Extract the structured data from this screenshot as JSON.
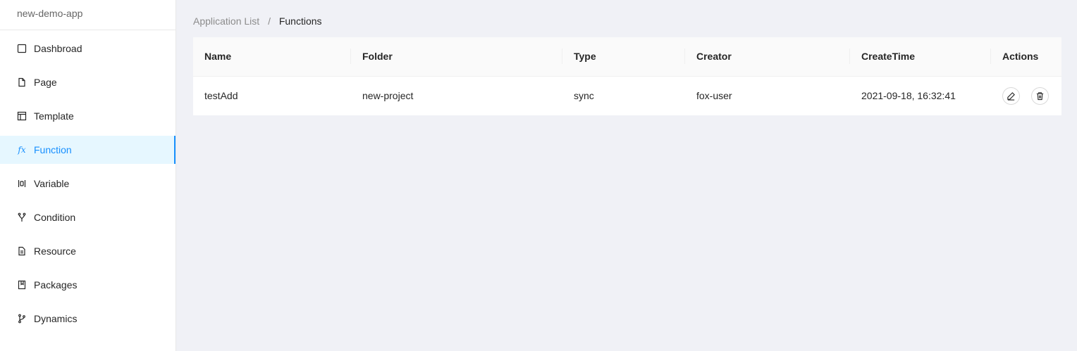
{
  "app": {
    "name": "new-demo-app"
  },
  "sidebar": {
    "items": [
      {
        "label": "Dashbroad",
        "icon": "square-icon",
        "active": false
      },
      {
        "label": "Page",
        "icon": "file-icon",
        "active": false
      },
      {
        "label": "Template",
        "icon": "layout-icon",
        "active": false
      },
      {
        "label": "Function",
        "icon": "fx-icon",
        "active": true
      },
      {
        "label": "Variable",
        "icon": "variable-icon",
        "active": false
      },
      {
        "label": "Condition",
        "icon": "branch-icon",
        "active": false
      },
      {
        "label": "Resource",
        "icon": "file-text-icon",
        "active": false
      },
      {
        "label": "Packages",
        "icon": "bookmark-icon",
        "active": false
      },
      {
        "label": "Dynamics",
        "icon": "git-branch-icon",
        "active": false
      }
    ]
  },
  "breadcrumb": {
    "parent": "Application List",
    "separator": "/",
    "current": "Functions"
  },
  "table": {
    "columns": [
      "Name",
      "Folder",
      "Type",
      "Creator",
      "CreateTime",
      "Actions"
    ],
    "rows": [
      {
        "name": "testAdd",
        "folder": "new-project",
        "type": "sync",
        "creator": "fox-user",
        "create_time": "2021-09-18, 16:32:41"
      }
    ]
  },
  "colors": {
    "accent": "#1890ff",
    "active_bg": "#e6f7ff",
    "page_bg": "#f0f1f6"
  }
}
